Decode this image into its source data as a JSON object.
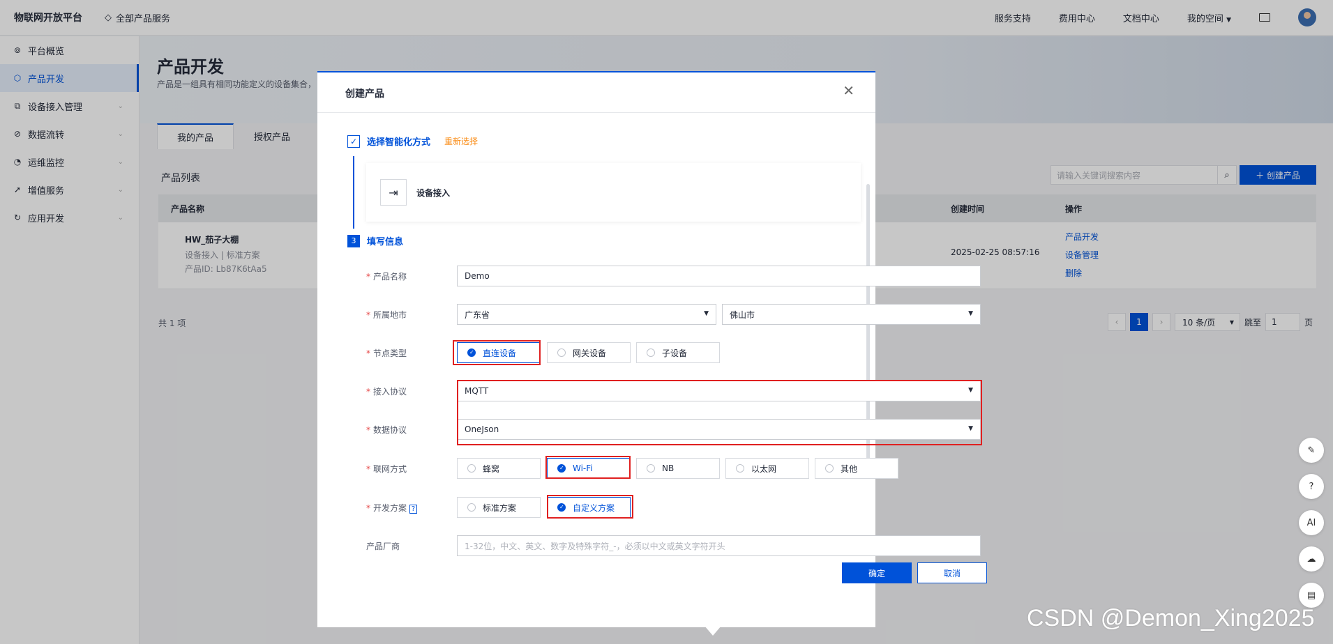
{
  "topbar": {
    "logo": "物联网开放平台",
    "all_products": "全部产品服务",
    "nav": [
      "服务支持",
      "费用中心",
      "文档中心",
      "我的空间"
    ]
  },
  "sidebar": {
    "items": [
      {
        "label": "平台概览",
        "icon": "gauge-icon"
      },
      {
        "label": "产品开发",
        "icon": "cube-icon"
      },
      {
        "label": "设备接入管理",
        "icon": "device-icon"
      },
      {
        "label": "数据流转",
        "icon": "flow-icon"
      },
      {
        "label": "运维监控",
        "icon": "monitor-icon"
      },
      {
        "label": "增值服务",
        "icon": "rocket-icon"
      },
      {
        "label": "应用开发",
        "icon": "code-icon"
      }
    ]
  },
  "page": {
    "title": "产品开发",
    "desc": "产品是一组具有相同功能定义的设备集合，",
    "tabs": [
      "我的产品",
      "授权产品"
    ],
    "list_title": "产品列表",
    "search_placeholder": "请输入关键词搜索内容",
    "create_button": "＋ 创建产品",
    "columns": [
      "产品名称",
      "创建时间",
      "操作"
    ],
    "row": {
      "name": "HW_茄子大棚",
      "sub": "设备接入 | 标准方案",
      "id": "产品ID:  Lb87K6tAa5",
      "date": "2025-02-25 08:57:16",
      "ops": [
        "产品开发",
        "设备管理",
        "删除"
      ]
    },
    "total": "共 1 项",
    "pager": {
      "current": "1",
      "size": "10 条/页",
      "jump_label": "跳至",
      "jump_value": "1",
      "page_unit": "页"
    }
  },
  "modal": {
    "title": "创建产品",
    "step1": {
      "label": "选择智能化方式",
      "reselect": "重新选择",
      "method": "设备接入"
    },
    "step3": {
      "num": "3",
      "label": "填写信息"
    },
    "fields": {
      "name_label": "产品名称",
      "name_value": "Demo",
      "city_label": "所属地市",
      "province": "广东省",
      "city": "佛山市",
      "node_label": "节点类型",
      "node_opts": [
        "直连设备",
        "网关设备",
        "子设备"
      ],
      "protocol_label": "接入协议",
      "protocol_value": "MQTT",
      "data_label": "数据协议",
      "data_value": "OneJson",
      "net_label": "联网方式",
      "net_opts": [
        "蜂窝",
        "Wi-Fi",
        "NB",
        "以太网",
        "其他"
      ],
      "dev_label": "开发方案",
      "dev_opts": [
        "标准方案",
        "自定义方案"
      ],
      "vendor_label": "产品厂商",
      "vendor_placeholder": "1-32位，中文、英文、数字及特殊字符_-，必须以中文或英文字符开头"
    },
    "ok": "确定",
    "cancel": "取消"
  },
  "floats": [
    "edit-icon",
    "help-icon",
    "AI",
    "cloud-icon",
    "panel-icon"
  ],
  "watermark": "CSDN @Demon_Xing2025",
  "colors": {
    "primary": "#0052d9",
    "highlight": "#e02020",
    "warning": "#fa8c16"
  }
}
